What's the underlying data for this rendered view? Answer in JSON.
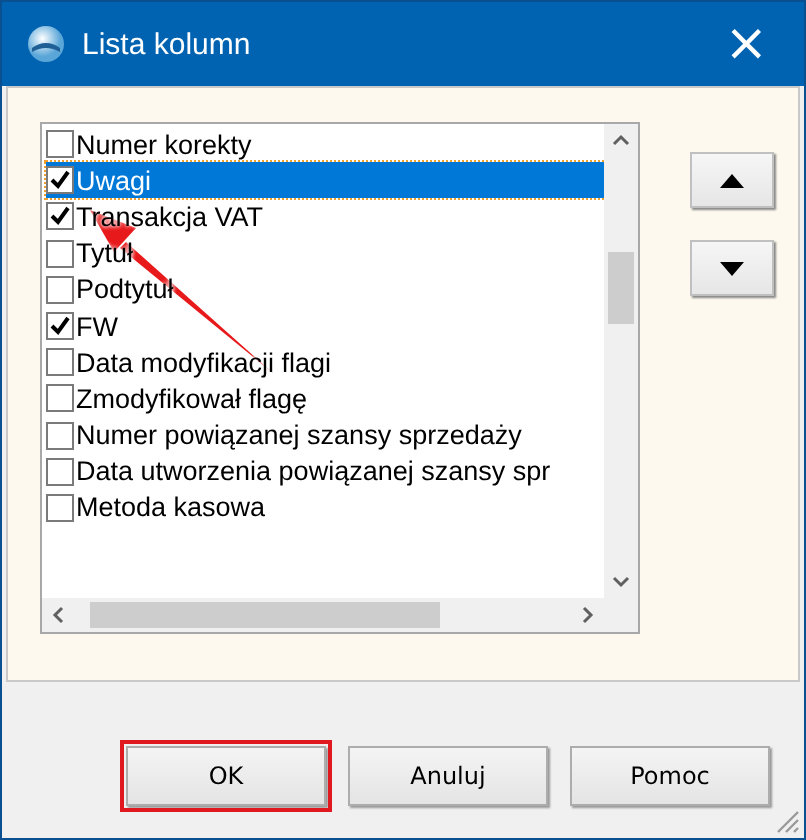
{
  "window": {
    "title": "Lista kolumn",
    "close": "×"
  },
  "columns": [
    {
      "label": "Numer korekty",
      "checked": false,
      "selected": false
    },
    {
      "label": "Uwagi",
      "checked": true,
      "selected": true
    },
    {
      "label": "Transakcja VAT",
      "checked": true,
      "selected": false
    },
    {
      "label": "Tytuł",
      "checked": false,
      "selected": false
    },
    {
      "label": "Podtytuł",
      "checked": false,
      "selected": false
    },
    {
      "label": "FW",
      "checked": true,
      "selected": false
    },
    {
      "label": "Data modyfikacji flagi",
      "checked": false,
      "selected": false
    },
    {
      "label": "Zmodyfikował flagę",
      "checked": false,
      "selected": false
    },
    {
      "label": "Numer powiązanej szansy sprzedaży",
      "checked": false,
      "selected": false
    },
    {
      "label": "Data utworzenia powiązanej szansy spr",
      "checked": false,
      "selected": false
    },
    {
      "label": "Metoda kasowa",
      "checked": false,
      "selected": false
    }
  ],
  "buttons": [
    {
      "label": "OK",
      "highlighted": true
    },
    {
      "label": "Anuluj",
      "highlighted": false
    },
    {
      "label": "Pomoc",
      "highlighted": false
    }
  ]
}
